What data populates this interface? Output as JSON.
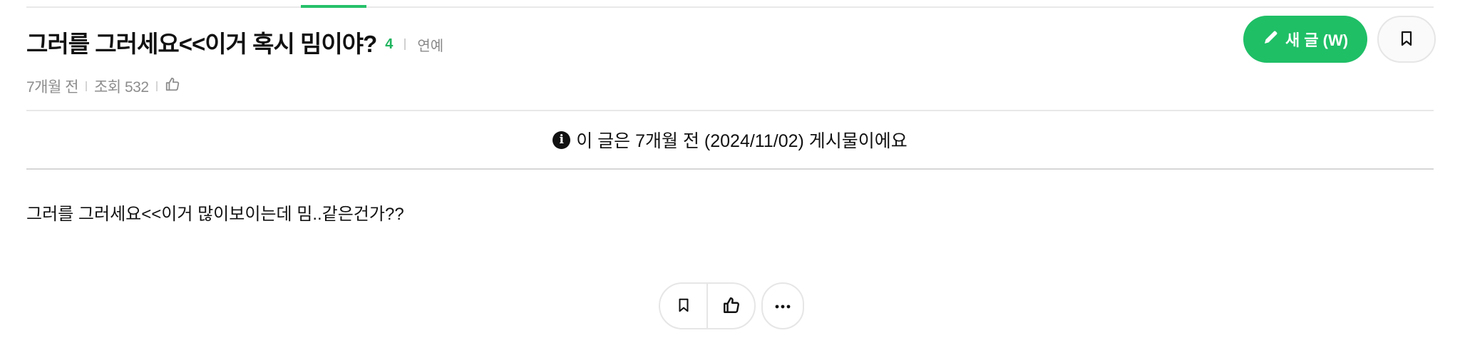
{
  "post": {
    "title": "그러를 그러세요<<이거 혹시 밈이야?",
    "comment_count": "4",
    "category": "연예",
    "meta": {
      "time_ago": "7개월 전",
      "views": "조회 532"
    },
    "notice": "이 글은 7개월 전 (2024/11/02) 게시물이에요",
    "body": "그러를 그러세요<<이거 많이보이는데 밈..같은건가??"
  },
  "toolbar": {
    "write_label": "새 글 (W)"
  },
  "colors": {
    "accent": "#1fbf66",
    "comment_count": "#1fb45e",
    "muted_text": "#8d8d8d"
  },
  "icons": [
    "pencil-icon",
    "bookmark-icon",
    "thumbs-up-icon",
    "info-icon",
    "more-icon"
  ]
}
